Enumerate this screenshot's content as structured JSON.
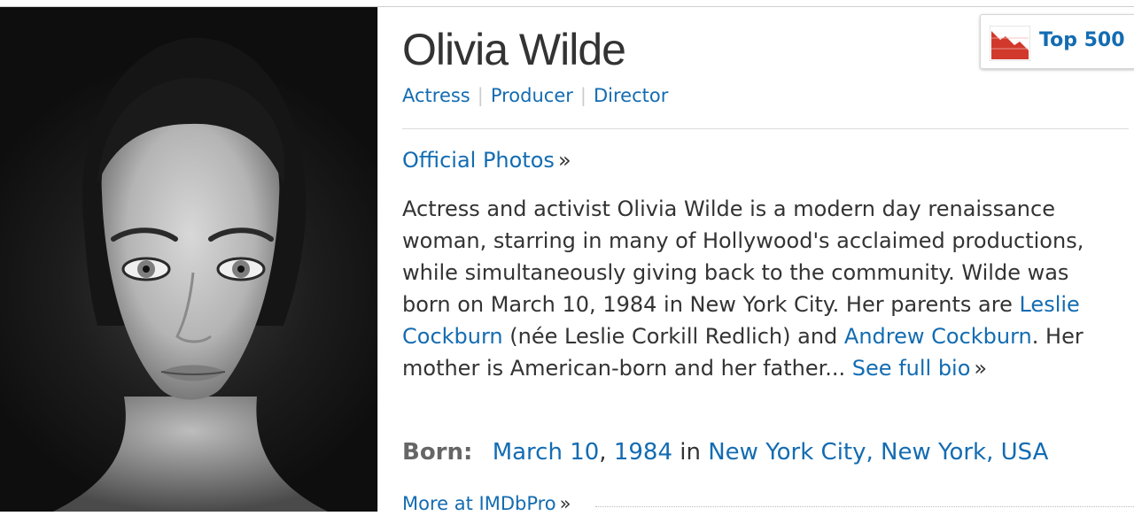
{
  "person": {
    "name": "Olivia Wilde",
    "jobs": [
      "Actress",
      "Producer",
      "Director"
    ]
  },
  "media": {
    "official_photos_label": "Official Photos",
    "raquo": "»"
  },
  "bio": {
    "text_1": "Actress and activist Olivia Wilde is a modern day renaissance woman, starring in many of Hollywood's acclaimed productions, while simultaneously giving back to the community. Wilde was born on March 10, 1984 in New York City. Her parents are ",
    "link_mother": "Leslie Cockburn",
    "text_2": " (née Leslie Corkill Redlich) and ",
    "link_father": "Andrew Cockburn",
    "text_3": ". Her mother is American-born and her father... ",
    "see_full_bio": "See full bio"
  },
  "born": {
    "label": "Born:",
    "date_month_day": "March 10",
    "comma": ",",
    "year": "1984",
    "in_word": "in",
    "place": "New York City, New York, USA"
  },
  "more_link": "More at IMDbPro",
  "top500": {
    "label": "Top 500",
    "icon": "starmeter-chart-icon",
    "color": "#d0392b"
  },
  "colors": {
    "link": "#136cb2",
    "text": "#333333"
  }
}
